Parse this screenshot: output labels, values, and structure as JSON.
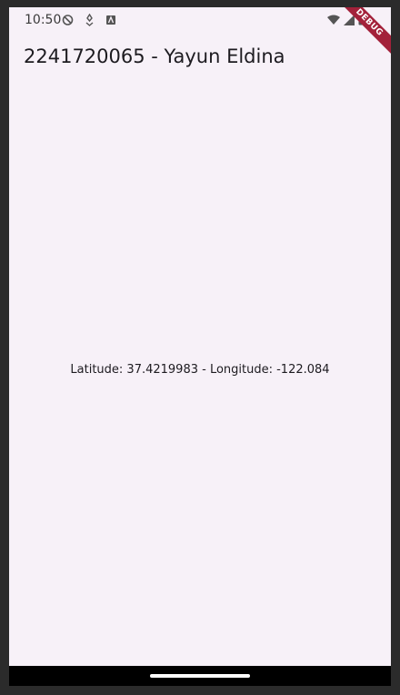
{
  "status_bar": {
    "time": "10:50",
    "left_icons": [
      "shield-icon",
      "pin-icon",
      "notification-icon"
    ],
    "right_icons": [
      "wifi-icon",
      "signal-icon",
      "battery-icon"
    ]
  },
  "debug_banner": {
    "label": "DEBUG",
    "color": "#a3213a"
  },
  "app_bar": {
    "title": "2241720065 - Yayun Eldina"
  },
  "body": {
    "location_text": "Latitude: 37.4219983 - Longitude: -122.084"
  },
  "colors": {
    "background": "#f7f1f8",
    "frame": "#2b2b2b",
    "text": "#1d1b20"
  }
}
